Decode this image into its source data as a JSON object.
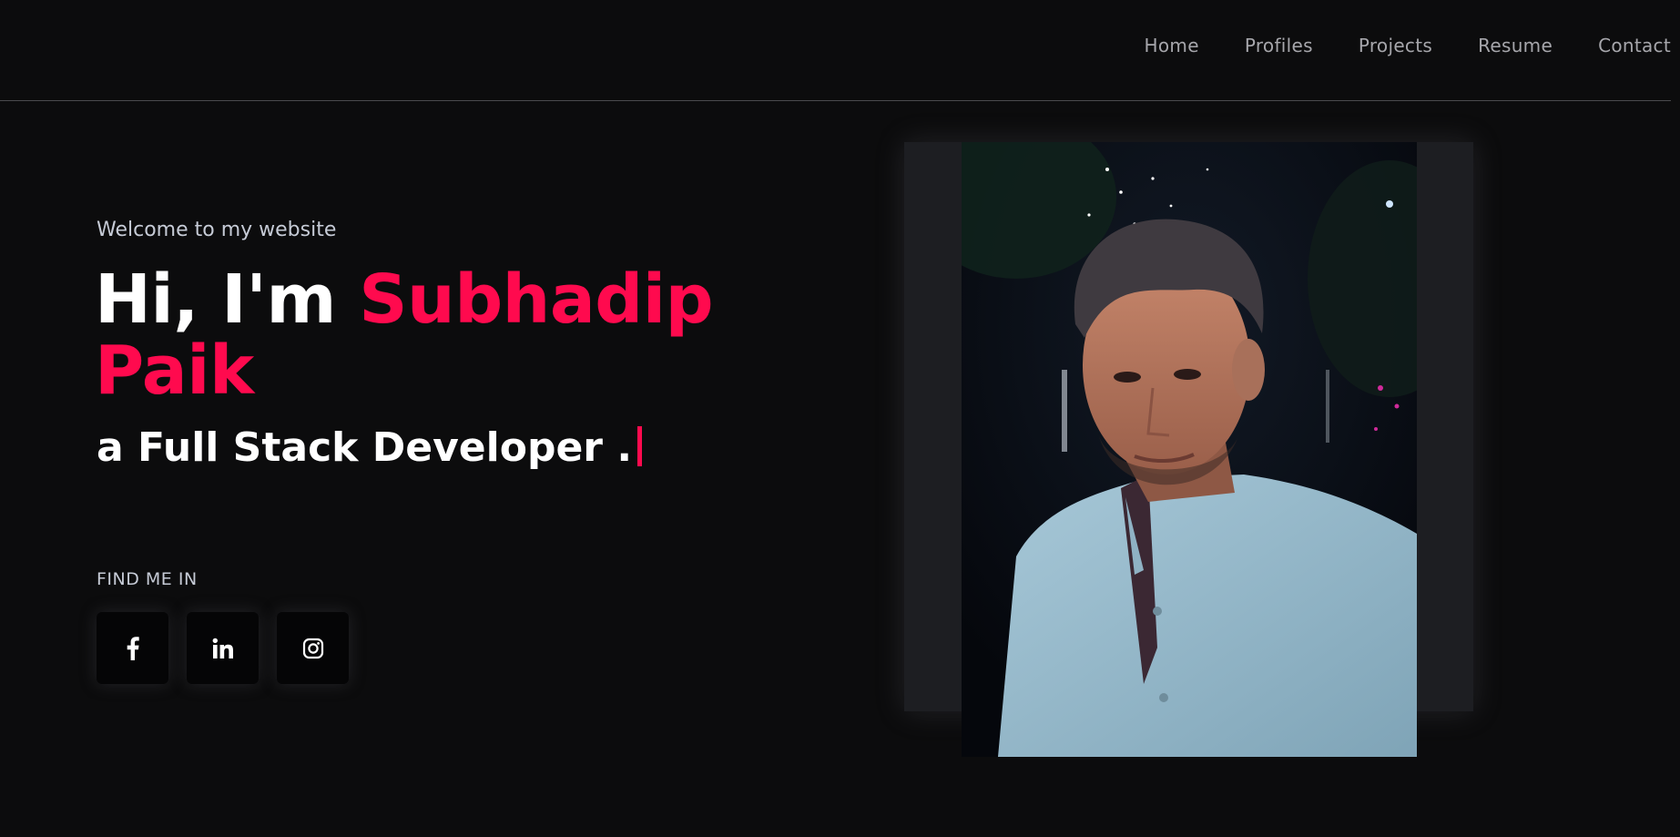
{
  "nav": {
    "items": [
      {
        "label": "Home"
      },
      {
        "label": "Profiles"
      },
      {
        "label": "Projects"
      },
      {
        "label": "Resume"
      },
      {
        "label": "Contact"
      }
    ]
  },
  "hero": {
    "welcome": "Welcome to my website",
    "greeting": "Hi, I'm ",
    "name": "Subhadip Paik",
    "role": "a Full Stack Developer ."
  },
  "social": {
    "heading": "FIND ME IN",
    "links": [
      {
        "icon": "facebook-icon"
      },
      {
        "icon": "linkedin-icon"
      },
      {
        "icon": "instagram-icon"
      }
    ]
  },
  "colors": {
    "background": "#0c0c0d",
    "accent": "#ff0a4e",
    "nav_text": "#a6a6ab",
    "muted_text": "#c6cbd6"
  }
}
